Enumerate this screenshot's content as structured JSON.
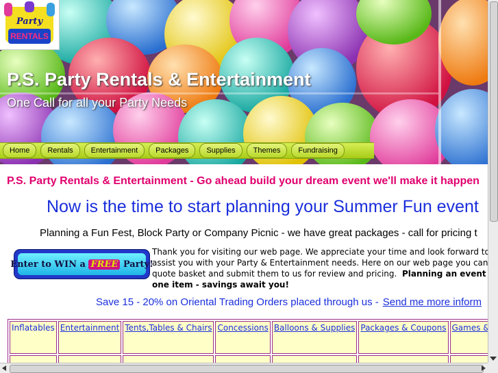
{
  "logo": {
    "text_line1": "Party",
    "text_line2": "RENTALS"
  },
  "header": {
    "title": "P.S. Party Rentals & Entertainment",
    "tagline": "One Call for all your Party Needs"
  },
  "nav": {
    "items": [
      {
        "label": "Home"
      },
      {
        "label": "Rentals"
      },
      {
        "label": "Entertainment"
      },
      {
        "label": "Packages"
      },
      {
        "label": "Supplies"
      },
      {
        "label": "Themes"
      },
      {
        "label": "Fundraising"
      }
    ]
  },
  "main": {
    "headline_pink": "P.S. Party Rentals & Entertainment - Go ahead build your dream event we'll make it happen",
    "headline_blue": "Now is the time to start planning your Summer Fun event",
    "planning_line": "Planning a Fun Fest, Block Party or Company Picnic - we have great packages - call for pricing t",
    "win_badge": {
      "pre": "Enter to WIN a",
      "free": "FREE",
      "post": "Party!"
    },
    "intro": {
      "line1": "Thank you for visiting our web page.  We appreciate your time and look forward to bein",
      "line2": "assist you with your Party & Entertainment needs.  Here on our web page you can add",
      "line3_plain": "quote basket and submit them to us for review and pricing.",
      "line3_bold": "Planning an event with",
      "line4_bold": "one item - savings await you!"
    },
    "save_text": "Save 15 - 20% on Oriental Trading Orders placed through us -",
    "save_link": "Send me more inform"
  },
  "categories": [
    {
      "label": "Inflatables",
      "link": false
    },
    {
      "label": "Entertainment",
      "link": true
    },
    {
      "label": "Tents,Tables  & Chairs",
      "link": true
    },
    {
      "label": "Concessions",
      "link": true
    },
    {
      "label": "Balloons & Supplies",
      "link": true
    },
    {
      "label": " Packages & Coupons",
      "link": true
    },
    {
      "label": "Games &",
      "link": true
    }
  ],
  "colors": {
    "pink_headline": "#e0006e",
    "blue_text": "#1a2edb",
    "nav_green": "#b8d82a",
    "table_cell_bg": "#ffffc8",
    "table_border": "#9a2a8a"
  }
}
